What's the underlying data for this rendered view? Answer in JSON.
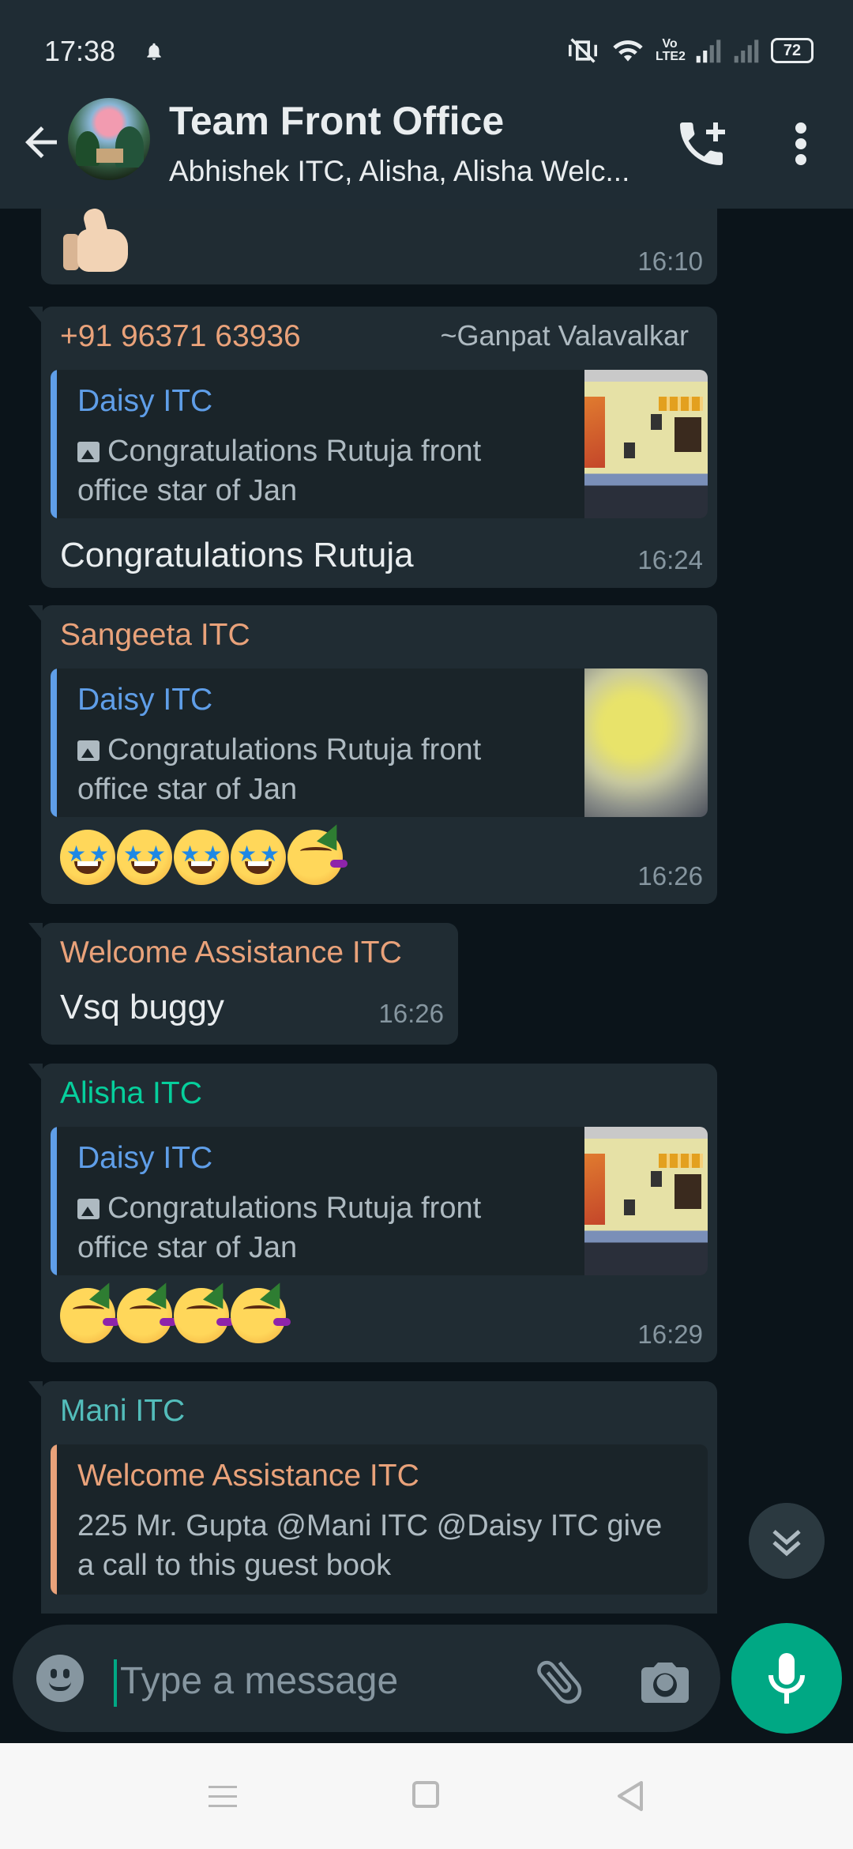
{
  "status_bar": {
    "time": "17:38",
    "network_badge": "Vo LTE2",
    "battery": "72"
  },
  "header": {
    "title": "Team Front Office",
    "subtitle": "Abhishek ITC, Alisha, Alisha Welc..."
  },
  "messages": [
    {
      "type": "emoji",
      "emoji": "thumbs-up",
      "time": "16:10"
    },
    {
      "sender": "+91 96371 63936",
      "sender_color": "#e9a27a",
      "alias": "~Ganpat Valavalkar",
      "quote": {
        "author": "Daisy ITC",
        "text": "Congratulations Rutuja front office  star of Jan"
      },
      "text": "Congratulations Rutuja",
      "time": "16:24"
    },
    {
      "sender": "Sangeeta ITC",
      "sender_color": "#e9a27a",
      "quote": {
        "author": "Daisy ITC",
        "text": "Congratulations Rutuja front office  star of Jan"
      },
      "emojis": [
        "star-struck",
        "star-struck",
        "star-struck",
        "star-struck",
        "partying-face"
      ],
      "time": "16:26"
    },
    {
      "sender": "Welcome Assistance ITC",
      "sender_color": "#e9a27a",
      "text": "Vsq buggy",
      "time": "16:26"
    },
    {
      "sender": "Alisha ITC",
      "sender_color": "#06cf9c",
      "quote": {
        "author": "Daisy ITC",
        "text": "Congratulations Rutuja front office  star of Jan"
      },
      "emojis": [
        "partying-face",
        "partying-face",
        "partying-face",
        "partying-face"
      ],
      "time": "16:29"
    },
    {
      "sender": "Mani ITC",
      "sender_color": "#53bdbb",
      "quote": {
        "author": "Welcome Assistance ITC",
        "author_color": "#e9a27a",
        "text": "225 Mr. Gupta @Mani ITC @Daisy ITC give a call to this guest book"
      }
    }
  ],
  "composer": {
    "placeholder": "Type a message"
  },
  "icons": {
    "back": "arrow-left-icon",
    "call": "add-call-icon",
    "menu": "more-vert-icon",
    "emoji": "emoji-icon",
    "attach": "paperclip-icon",
    "camera": "camera-icon",
    "mic": "mic-icon",
    "scroll": "double-chevron-down-icon"
  },
  "colors": {
    "header_bg": "#1f2c34",
    "chat_bg": "#0b141a",
    "bubble_bg": "#202c33",
    "accent": "#00a884",
    "quote_author": "#5f9ee8"
  }
}
